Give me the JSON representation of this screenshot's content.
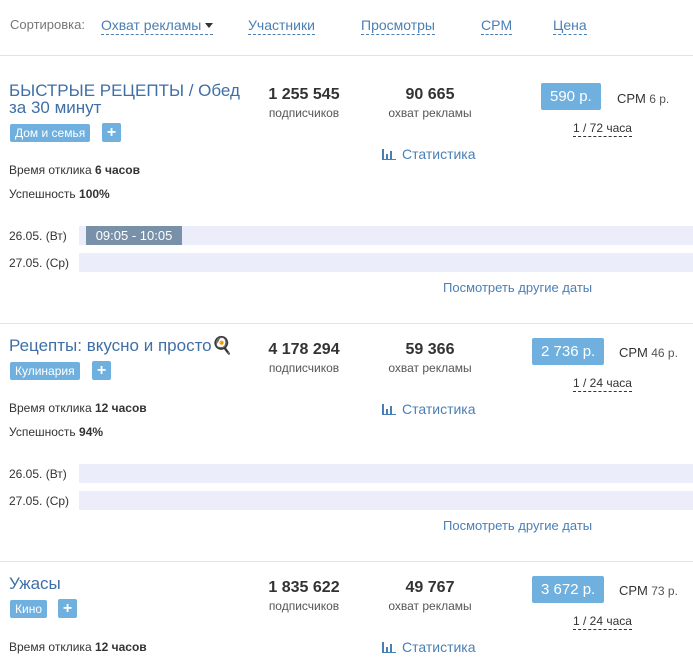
{
  "sort": {
    "label": "Сортировка:",
    "options": [
      "Охват рекламы",
      "Участники",
      "Просмотры",
      "CPM",
      "Цена"
    ]
  },
  "labels": {
    "subscribers": "подписчиков",
    "reach": "охват рекламы",
    "statistics": "Статистика",
    "response_prefix": "Время отклика",
    "success_prefix": "Успешность",
    "other_dates": "Посмотреть другие даты",
    "cpm": "CPM",
    "plus": "+"
  },
  "channels": [
    {
      "title": "БЫСТРЫЕ РЕЦЕПТЫ / Обед за 30 минут",
      "tag": "Дом и семья",
      "subscribers": "1 255 545",
      "reach": "90 665",
      "price": "590 р.",
      "cpm": "6 р.",
      "period": "1 / 72 часа",
      "response": "6 часов",
      "success": "100%",
      "dates": [
        {
          "label": "26.05. (Вт)",
          "slot": "09:05 - 10:05"
        },
        {
          "label": "27.05. (Ср)",
          "slot": ""
        }
      ]
    },
    {
      "title": "Рецепты: вкусно и просто🍳",
      "tag": "Кулинария",
      "subscribers": "4 178 294",
      "reach": "59 366",
      "price": "2 736 р.",
      "cpm": "46 р.",
      "period": "1 / 24 часа",
      "response": "12 часов",
      "success": "94%",
      "dates": [
        {
          "label": "26.05. (Вт)",
          "slot": ""
        },
        {
          "label": "27.05. (Ср)",
          "slot": ""
        }
      ]
    },
    {
      "title": "Ужасы",
      "tag": "Кино",
      "subscribers": "1 835 622",
      "reach": "49 767",
      "price": "3 672 р.",
      "cpm": "73 р.",
      "period": "1 / 24 часа",
      "response": "12 часов"
    }
  ]
}
